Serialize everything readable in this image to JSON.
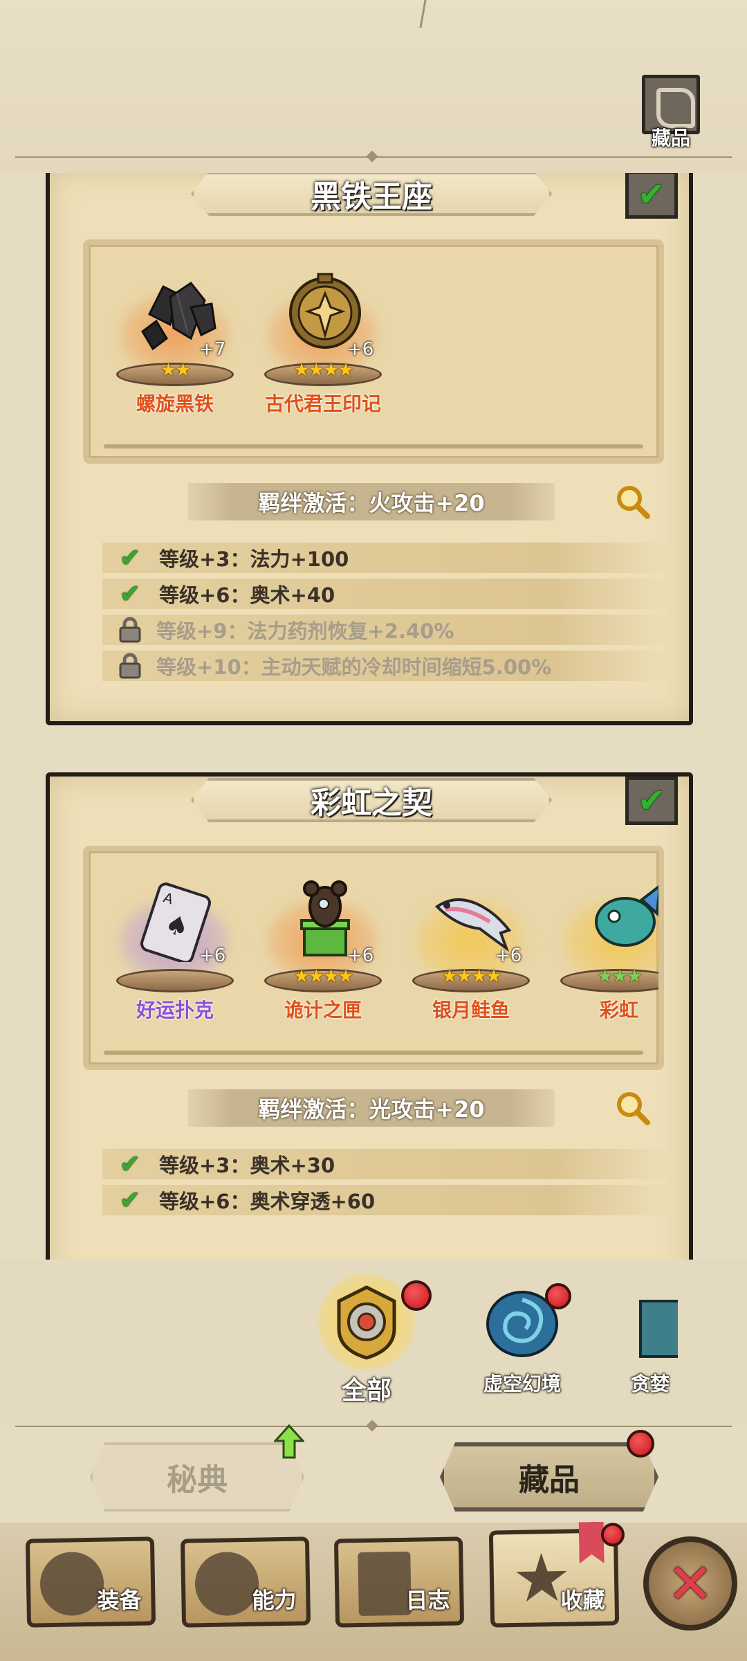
{
  "header": {
    "collection_label": "藏品"
  },
  "sets": [
    {
      "title": "黑铁王座",
      "items": [
        {
          "name": "螺旋黑铁",
          "stars": "★★",
          "plus": "+7",
          "name_color": "#e0511a",
          "glow": "#f08a3a"
        },
        {
          "name": "古代君王印记",
          "stars": "★★★★",
          "plus": "+6",
          "name_color": "#e0511a",
          "glow": "#f08a3a"
        }
      ],
      "bond": "羁绊激活：火攻击+20",
      "bonuses": [
        {
          "text": "等级+3：法力+100",
          "state": "done"
        },
        {
          "text": "等级+6：奥术+40",
          "state": "done"
        },
        {
          "text": "等级+9：法力药剂恢复+2.40%",
          "state": "locked"
        },
        {
          "text": "等级+10：主动天赋的冷却时间缩短5.00%",
          "state": "locked"
        }
      ]
    },
    {
      "title": "彩虹之契",
      "items": [
        {
          "name": "好运扑克",
          "stars": "",
          "plus": "+6",
          "name_color": "#8b4fd8",
          "glow": "#b08ae0"
        },
        {
          "name": "诡计之匣",
          "stars": "★★★★",
          "plus": "+6",
          "name_color": "#e0511a",
          "glow": "#f08a3a"
        },
        {
          "name": "银月鲑鱼",
          "stars": "★★★★",
          "plus": "+6",
          "name_color": "#e0511a",
          "glow": "#f5c23c"
        },
        {
          "name": "彩虹",
          "stars": "★★★",
          "plus": "",
          "name_color": "#e0511a",
          "glow": "#f5c23c"
        }
      ],
      "bond": "羁绊激活：光攻击+20",
      "bonuses": [
        {
          "text": "等级+3：奥术+30",
          "state": "done"
        },
        {
          "text": "等级+6：奥术穿透+60",
          "state": "done"
        }
      ]
    }
  ],
  "categories": [
    {
      "label": "全部"
    },
    {
      "label": "虚空幻境"
    },
    {
      "label": "贪婪"
    }
  ],
  "modes": {
    "codex": "秘典",
    "collection": "藏品"
  },
  "nav": [
    {
      "label": "装备"
    },
    {
      "label": "能力"
    },
    {
      "label": "日志"
    },
    {
      "label": "收藏"
    }
  ]
}
